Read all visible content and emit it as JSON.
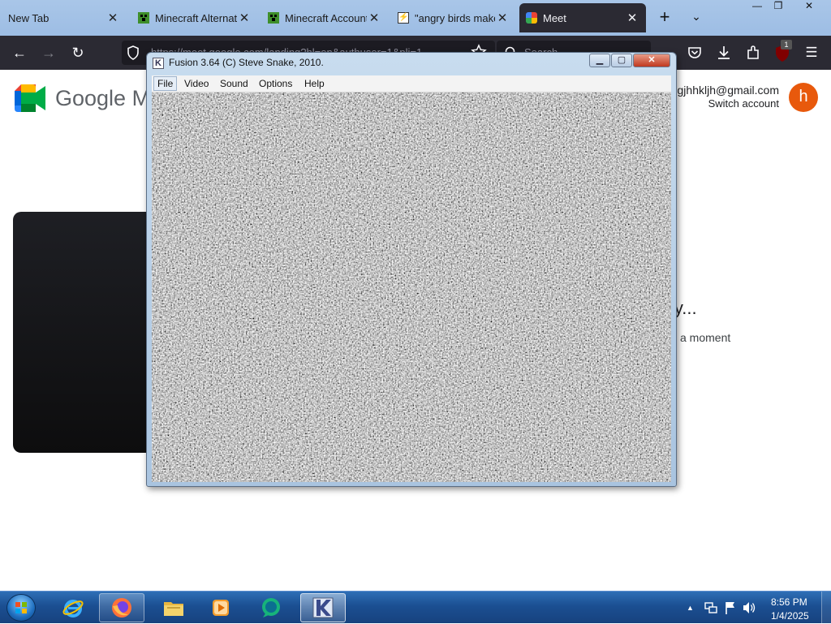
{
  "browser": {
    "tabs": [
      {
        "title": "New Tab",
        "icon": "none",
        "active": false
      },
      {
        "title": "Minecraft Alternati",
        "icon": "creeper-icon",
        "active": false
      },
      {
        "title": "Minecraft Account",
        "icon": "creeper-icon",
        "active": false
      },
      {
        "title": "\"angry birds maker",
        "icon": "bolt-icon",
        "active": false
      },
      {
        "title": "Meet",
        "icon": "meet-icon",
        "active": true
      }
    ],
    "tab_close_glyph": "✕",
    "new_tab_glyph": "+",
    "tab_list_glyph": "⌄",
    "window_buttons": {
      "minimize": "—",
      "restore": "❐",
      "close": "✕"
    },
    "nav": {
      "back": "←",
      "forward": "→",
      "reload": "↻"
    },
    "url_text": "https://meet.google.com/landing?hl=en&authuser=1&pli=1",
    "search_placeholder": "Search",
    "extensions_badge": "1",
    "menu_glyph": "☰"
  },
  "meet": {
    "wordmark": "Google M",
    "account_email": "gjhhkljh@gmail.com",
    "switch_account": "Switch account",
    "avatar_letter": "h",
    "ready_fragment": "ly...",
    "moment_fragment": "a moment",
    "brand_colors": {
      "green": "#00832d",
      "blue": "#0066da",
      "yellow": "#ffba00",
      "red": "#e94235"
    }
  },
  "fusion": {
    "title": "Fusion 3.64 (C) Steve Snake, 2010.",
    "icon_letter": "K",
    "menu": [
      "File",
      "Video",
      "Sound",
      "Options",
      "Help"
    ],
    "buttons": {
      "minimize": "▁",
      "maximize": "▢",
      "close": "✕"
    },
    "screen_content": "static noise"
  },
  "taskbar": {
    "pinned": [
      {
        "name": "internet-explorer-icon"
      },
      {
        "name": "firefox-icon"
      },
      {
        "name": "file-explorer-icon"
      },
      {
        "name": "media-player-icon"
      },
      {
        "name": "chat-app-icon"
      },
      {
        "name": "fusion-icon"
      }
    ],
    "tray_expand": "▲",
    "clock_time": "8:56 PM",
    "clock_date": "1/4/2025"
  }
}
